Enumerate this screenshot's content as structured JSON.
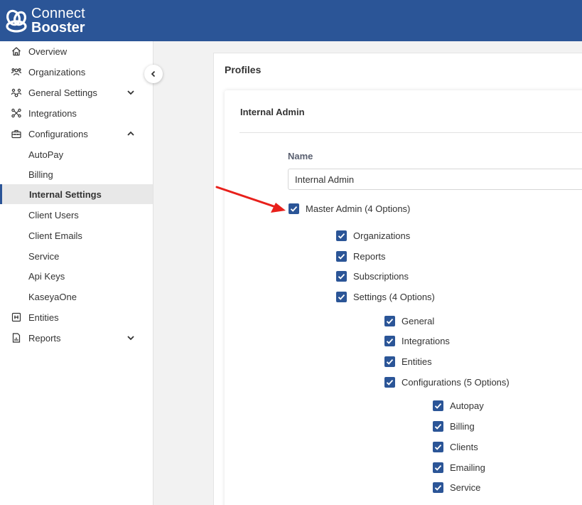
{
  "app": {
    "logo_line1": "Connect",
    "logo_line2": "Booster",
    "brand_color": "#2b5597",
    "accent_red": "#e8201b"
  },
  "sidebar": {
    "items": [
      {
        "label": "Overview",
        "icon": "home-icon"
      },
      {
        "label": "Organizations",
        "icon": "users-icon"
      },
      {
        "label": "General Settings",
        "icon": "people-settings-icon",
        "chevron": "chevron-down-icon"
      },
      {
        "label": "Integrations",
        "icon": "nodes-icon"
      },
      {
        "label": "Configurations",
        "icon": "toolbox-icon",
        "chevron": "chevron-up-icon"
      },
      {
        "label": "AutoPay"
      },
      {
        "label": "Billing"
      },
      {
        "label": "Internal Settings",
        "active": true
      },
      {
        "label": "Client Users"
      },
      {
        "label": "Client Emails"
      },
      {
        "label": "Service"
      },
      {
        "label": "Api Keys"
      },
      {
        "label": "KaseyaOne"
      },
      {
        "label": "Entities",
        "icon": "grid-icon"
      },
      {
        "label": "Reports",
        "icon": "report-icon",
        "chevron": "chevron-down-icon"
      }
    ]
  },
  "main": {
    "section_title": "Profiles",
    "profile_title": "Internal Admin",
    "name_label": "Name",
    "name_value": "Internal Admin",
    "checkboxes": [
      {
        "label": "Master Admin (4 Options)",
        "checked": true
      },
      {
        "label": "Organizations",
        "checked": true
      },
      {
        "label": "Reports",
        "checked": true
      },
      {
        "label": "Subscriptions",
        "checked": true
      },
      {
        "label": "Settings (4 Options)",
        "checked": true
      },
      {
        "label": "General",
        "checked": true
      },
      {
        "label": "Integrations",
        "checked": true
      },
      {
        "label": "Entities",
        "checked": true
      },
      {
        "label": "Configurations (5 Options)",
        "checked": true
      },
      {
        "label": "Autopay",
        "checked": true
      },
      {
        "label": "Billing",
        "checked": true
      },
      {
        "label": "Clients",
        "checked": true
      },
      {
        "label": "Emailing",
        "checked": true
      },
      {
        "label": "Service",
        "checked": true
      }
    ]
  }
}
